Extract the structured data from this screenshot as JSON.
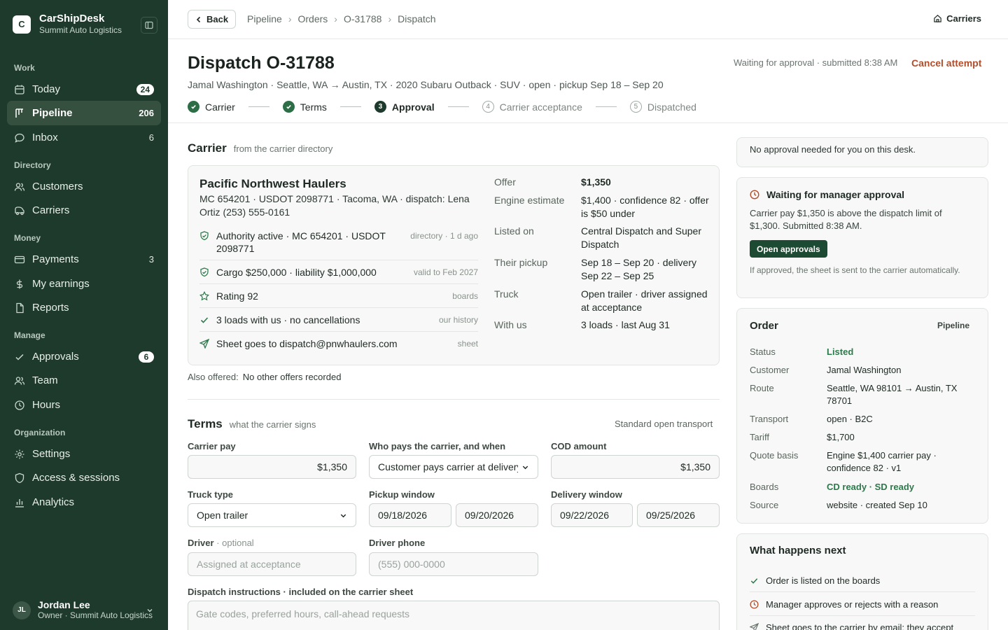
{
  "sidebar": {
    "brand": {
      "logo": "C",
      "name": "CarShipDesk",
      "sub": "Summit Auto Logistics"
    },
    "sections": {
      "work": "Work",
      "directory": "Directory",
      "money": "Money",
      "manage": "Manage",
      "organization": "Organization"
    },
    "items": [
      {
        "label": "Today",
        "count": "24",
        "icon": "calendar-icon"
      },
      {
        "label": "Pipeline",
        "count": "206",
        "icon": "pipeline-icon"
      },
      {
        "label": "Inbox",
        "count": "6",
        "icon": "chat-icon"
      },
      {
        "label": "Customers",
        "icon": "users-icon"
      },
      {
        "label": "Carriers",
        "icon": "truck-icon"
      },
      {
        "label": "Payments",
        "count": "3",
        "icon": "card-icon"
      },
      {
        "label": "My earnings",
        "icon": "dollar-icon"
      },
      {
        "label": "Reports",
        "icon": "file-icon"
      },
      {
        "label": "Approvals",
        "count": "6",
        "icon": "check-icon"
      },
      {
        "label": "Team",
        "icon": "team-icon"
      },
      {
        "label": "Hours",
        "icon": "clock-icon"
      },
      {
        "label": "Settings",
        "icon": "gear-icon"
      },
      {
        "label": "Access & sessions",
        "icon": "shield-icon"
      },
      {
        "label": "Analytics",
        "icon": "chart-icon"
      }
    ],
    "user": {
      "initials": "JL",
      "name": "Jordan Lee",
      "role": "Owner · Summit Auto Logistics"
    }
  },
  "topbar": {
    "back": "Back",
    "breadcrumb": [
      "Pipeline",
      "Orders",
      "O-31788",
      "Dispatch"
    ],
    "carriers": "Carriers"
  },
  "header": {
    "title": "Dispatch O-31788",
    "meta": "Jamal Washington · Seattle, WA → Austin, TX · 2020 Subaru Outback · SUV · open · pickup Sep 18 – Sep 20",
    "status": "Waiting for approval · submitted 8:38 AM",
    "cancel": "Cancel attempt",
    "steps": [
      {
        "label": "Carrier",
        "state": "done"
      },
      {
        "label": "Terms",
        "state": "done"
      },
      {
        "num": "3",
        "label": "Approval",
        "state": "current"
      },
      {
        "num": "4",
        "label": "Carrier acceptance",
        "state": "todo"
      },
      {
        "num": "5",
        "label": "Dispatched",
        "state": "todo"
      }
    ]
  },
  "carrier": {
    "section_title": "Carrier",
    "section_sub": "from the carrier directory",
    "name": "Pacific Northwest Haulers",
    "info": "MC 654201 · USDOT 2098771 · Tacoma, WA · dispatch: Lena Ortiz (253) 555-0161",
    "checks": [
      {
        "text": "Authority active · MC 654201 · USDOT 2098771",
        "source": "directory · 1 d ago"
      },
      {
        "text": "Cargo $250,000 · liability $1,000,000",
        "source": "valid to Feb 2027"
      },
      {
        "text": "Rating 92",
        "source": "boards"
      },
      {
        "text": "3 loads with us · no cancellations",
        "source": "our history"
      },
      {
        "text": "Sheet goes to dispatch@pnwhaulers.com",
        "source": "sheet"
      }
    ],
    "details": [
      {
        "k": "Offer",
        "v": "$1,350"
      },
      {
        "k": "Engine estimate",
        "v": "$1,400 · confidence 82 · offer is $50 under"
      },
      {
        "k": "Listed on",
        "v": "Central Dispatch and Super Dispatch"
      },
      {
        "k": "Their pickup",
        "v": "Sep 18 – Sep 20 · delivery Sep 22 – Sep 25"
      },
      {
        "k": "Truck",
        "v": "Open trailer · driver assigned at acceptance"
      },
      {
        "k": "With us",
        "v": "3 loads · last Aug 31"
      }
    ],
    "also_label": "Also offered:",
    "also_value": "No other offers recorded"
  },
  "terms": {
    "section_title": "Terms",
    "section_sub": "what the carrier signs",
    "template": "Standard open transport",
    "carrier_pay_label": "Carrier pay",
    "carrier_pay": "$1,350",
    "who_pays_label": "Who pays the carrier, and when",
    "who_pays": "Customer pays carrier at delivery",
    "cod_label": "COD amount",
    "cod": "$1,350",
    "truck_label": "Truck type",
    "truck": "Open trailer",
    "pickup_label": "Pickup window",
    "pickup_from": "09/18/2026",
    "pickup_to": "09/20/2026",
    "delivery_label": "Delivery window",
    "delivery_from": "09/22/2026",
    "delivery_to": "09/25/2026",
    "driver_label": "Driver",
    "driver_optional": "· optional",
    "driver_placeholder": "Assigned at acceptance",
    "phone_label": "Driver phone",
    "phone_placeholder": "(555) 000-0000",
    "instructions_label": "Dispatch instructions · included on the carrier sheet",
    "instructions_placeholder": "Gate codes, preferred hours, call-ahead requests"
  },
  "right": {
    "no_approval": "No approval needed for you on this desk.",
    "wait_title": "Waiting for manager approval",
    "wait_text": "Carrier pay $1,350 is above the dispatch limit of $1,300. Submitted 8:38 AM.",
    "open_approvals": "Open approvals",
    "wait_note": "If approved, the sheet is sent to the carrier automatically.",
    "order_title": "Order",
    "order_link": "Pipeline",
    "order_rows": [
      {
        "k": "Status",
        "v": "Listed"
      },
      {
        "k": "Customer",
        "v": "Jamal Washington"
      },
      {
        "k": "Route",
        "v": "Seattle, WA 98101 → Austin, TX 78701"
      },
      {
        "k": "Transport",
        "v": "open · B2C"
      },
      {
        "k": "Tariff",
        "v": "$1,700"
      },
      {
        "k": "Quote basis",
        "v": "Engine $1,400 carrier pay · confidence 82 · v1"
      },
      {
        "k": "Boards",
        "v": "CD ready · SD ready"
      },
      {
        "k": "Source",
        "v": "website · created Sep 10"
      }
    ],
    "next_title": "What happens next",
    "next_items": [
      "Order is listed on the boards",
      "Manager approves or rejects with a reason",
      "Sheet goes to the carrier by email; they accept"
    ]
  },
  "colors": {
    "sidebar": "#1d3a2c",
    "accent": "#2c6e46",
    "cancel": "#b34d2a"
  }
}
